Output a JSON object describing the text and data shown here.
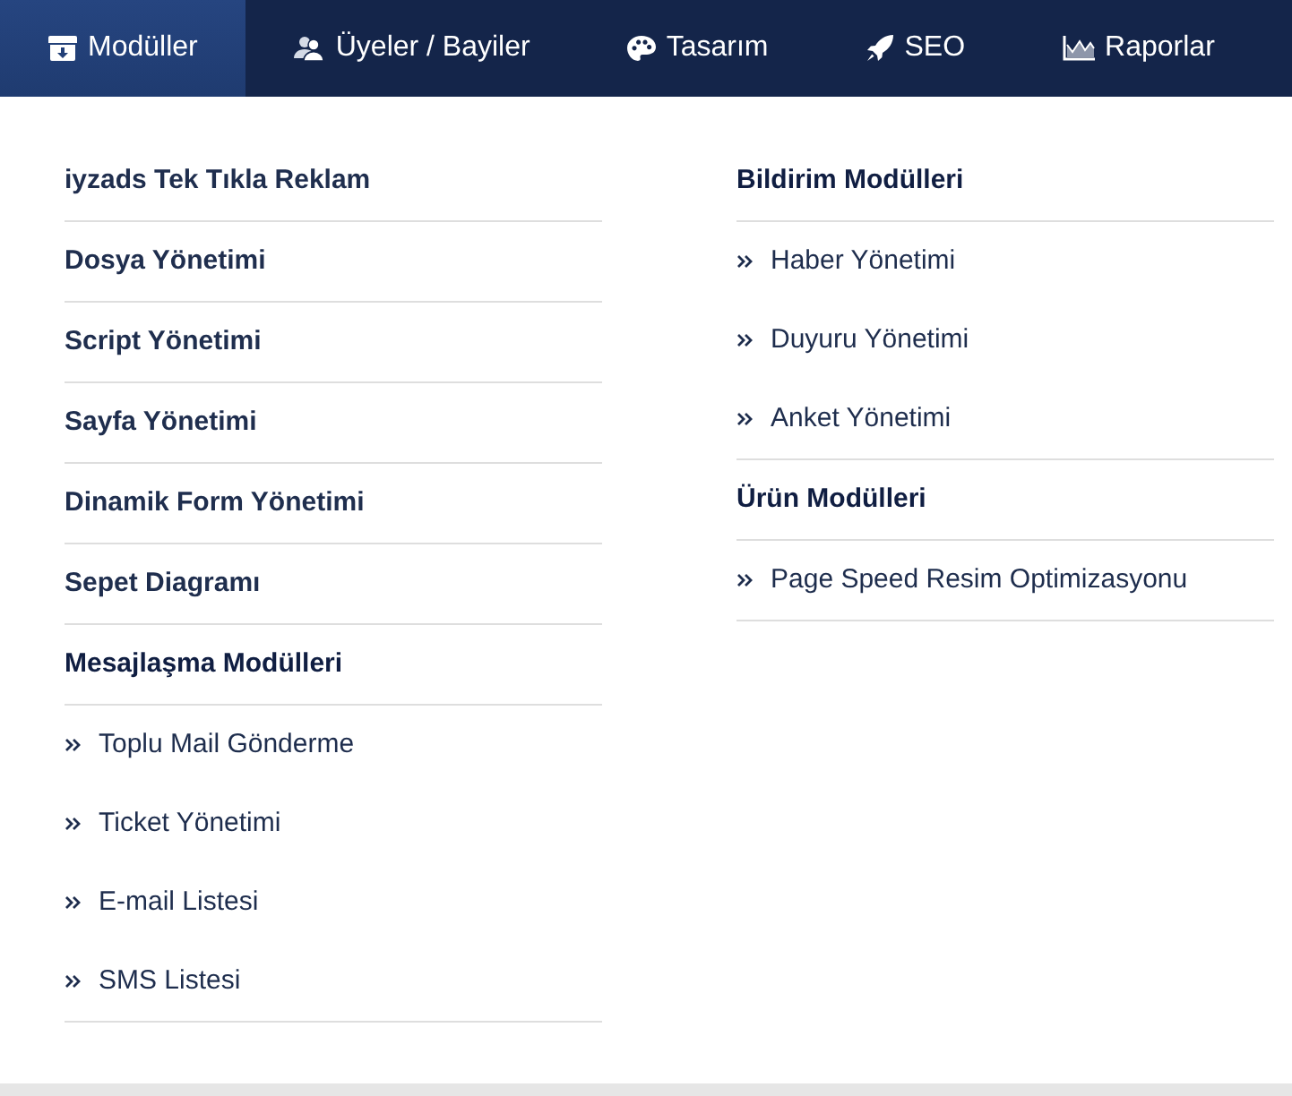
{
  "nav": {
    "tabs": [
      {
        "label": "Modüller",
        "selected": true
      },
      {
        "label": "Üyeler / Bayiler",
        "selected": false
      },
      {
        "label": "Tasarım",
        "selected": false
      },
      {
        "label": "SEO",
        "selected": false
      },
      {
        "label": "Raporlar",
        "selected": false
      }
    ]
  },
  "dropdown": {
    "columns": [
      {
        "items": [
          {
            "kind": "link",
            "label": "iyzads Tek Tıkla Reklam"
          },
          {
            "kind": "link",
            "label": "Dosya Yönetimi"
          },
          {
            "kind": "link",
            "label": "Script Yönetimi"
          },
          {
            "kind": "link",
            "label": "Sayfa Yönetimi"
          },
          {
            "kind": "link",
            "label": "Dinamik Form Yönetimi"
          },
          {
            "kind": "link",
            "label": "Sepet Diagramı"
          },
          {
            "kind": "group",
            "title": "Mesajlaşma Modülleri",
            "children": [
              {
                "label": "Toplu Mail Gönderme"
              },
              {
                "label": "Ticket Yönetimi"
              },
              {
                "label": "E-mail Listesi"
              },
              {
                "label": "SMS Listesi"
              }
            ]
          }
        ]
      },
      {
        "items": [
          {
            "kind": "group",
            "title": "Bildirim Modülleri",
            "children": [
              {
                "label": "Haber Yönetimi"
              },
              {
                "label": "Duyuru Yönetimi"
              },
              {
                "label": "Anket Yönetimi"
              }
            ]
          },
          {
            "kind": "group",
            "title": "Ürün Modülleri",
            "children": [
              {
                "label": "Page Speed Resim Optimizasyonu"
              }
            ]
          }
        ]
      }
    ]
  }
}
